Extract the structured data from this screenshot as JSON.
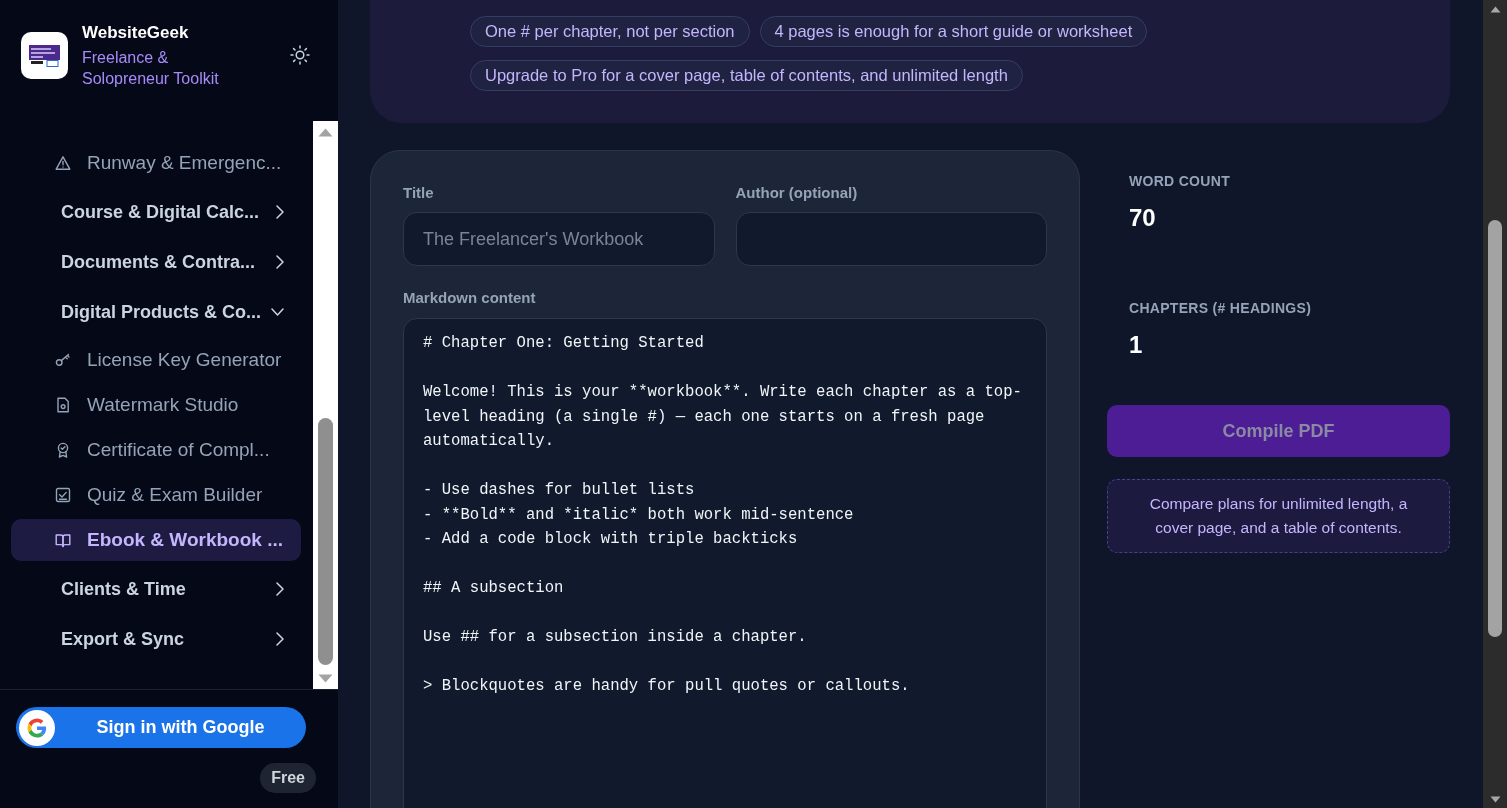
{
  "sidebar": {
    "brand": {
      "name": "WebsiteGeek",
      "tagline": "Freelance & Solopreneur Toolkit"
    },
    "nav": [
      {
        "kind": "tool",
        "label": "Runway & Emergenc...",
        "selected": false
      },
      {
        "kind": "group",
        "label": "Course & Digital Calc...",
        "expanded": false
      },
      {
        "kind": "group",
        "label": "Documents & Contra...",
        "expanded": false
      },
      {
        "kind": "group",
        "label": "Digital Products & Co...",
        "expanded": true,
        "children": [
          {
            "kind": "tool",
            "label": "License Key Generator",
            "selected": false
          },
          {
            "kind": "tool",
            "label": "Watermark Studio",
            "selected": false
          },
          {
            "kind": "tool",
            "label": "Certificate of Compl...",
            "selected": false
          },
          {
            "kind": "tool",
            "label": "Quiz & Exam Builder",
            "selected": false
          },
          {
            "kind": "tool",
            "label": "Ebook & Workbook ...",
            "selected": true
          }
        ]
      },
      {
        "kind": "group",
        "label": "Clients & Time",
        "expanded": false
      },
      {
        "kind": "group",
        "label": "Export & Sync",
        "expanded": false
      }
    ],
    "sign_in_button": "Sign in with Google",
    "plan_badge": "Free"
  },
  "tips": {
    "chips": [
      "One # per chapter, not per section",
      "4 pages is enough for a short guide or worksheet",
      "Upgrade to Pro for a cover page, table of contents, and unlimited length"
    ]
  },
  "form": {
    "fields": [
      {
        "label": "Title",
        "placeholder": "The Freelancer's Workbook"
      },
      {
        "label": "Author (optional)"
      }
    ],
    "content": {
      "label": "Markdown content",
      "value": "# Chapter One: Getting Started\n\nWelcome! This is your **workbook**. Write each chapter as a top-level heading (a single #) — each one starts on a fresh page automatically.\n\n- Use dashes for bullet lists\n- **Bold** and *italic* both work mid-sentence\n- Add a code block with triple backticks\n\n## A subsection\n\nUse ## for a subsection inside a chapter.\n\n> Blockquotes are handy for pull quotes or callouts."
    }
  },
  "stats": [
    {
      "label": "WORD COUNT",
      "value": "70"
    },
    {
      "label": "CHAPTERS (# HEADINGS)",
      "value": "1"
    }
  ],
  "compile_button": {
    "label": "Compile PDF",
    "disabled": true
  },
  "upgrade_note": "Compare plans for unlimited length, a cover page, and a table of contents."
}
